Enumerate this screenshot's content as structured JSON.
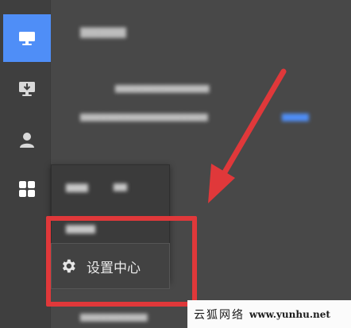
{
  "sidebar": {
    "items": [
      {
        "icon": "monitor-icon",
        "active": true
      },
      {
        "icon": "download-monitor-icon",
        "active": false
      },
      {
        "icon": "user-icon",
        "active": false
      },
      {
        "icon": "apps-grid-icon",
        "active": false
      }
    ]
  },
  "settings_menu": {
    "label": "设置中心",
    "icon": "gear-icon"
  },
  "watermark": {
    "brand": "云狐网络",
    "url": "www.yunhu.net"
  },
  "colors": {
    "accent": "#4f8ef7",
    "highlight": "#e0383a",
    "background": "#484848",
    "sidebar": "#3f3f3f"
  }
}
